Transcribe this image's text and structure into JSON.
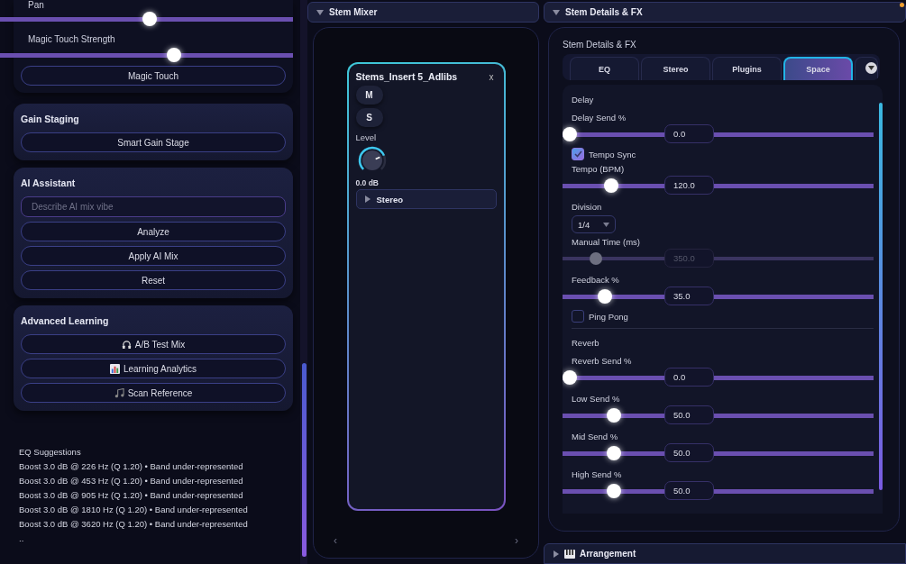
{
  "left_panel": {
    "sliders": [
      {
        "label": "Pan",
        "level": 0.51
      },
      {
        "label": "Magic Touch Strength",
        "level": 0.6
      }
    ],
    "magic_button": "Magic Touch",
    "cards": [
      {
        "title": "Gain Staging",
        "items": [
          {
            "kind": "button",
            "label": "Smart Gain Stage"
          }
        ]
      },
      {
        "title": "AI Assistant",
        "items": [
          {
            "kind": "input",
            "placeholder": "Describe AI mix vibe"
          },
          {
            "kind": "button",
            "label": "Analyze"
          },
          {
            "kind": "button",
            "label": "Apply AI Mix"
          },
          {
            "kind": "button",
            "label": "Reset"
          }
        ]
      },
      {
        "title": "Advanced Learning",
        "items": [
          {
            "kind": "icon-button",
            "label": "A/B Test Mix"
          },
          {
            "kind": "icon-button",
            "label": "Learning Analytics"
          },
          {
            "kind": "icon-button",
            "label": "Scan Reference"
          }
        ]
      }
    ],
    "eq_suggestions": {
      "title": "EQ Suggestions",
      "lines": [
        "Boost 3.0 dB @ 226 Hz (Q 1.20) • Band under-represented",
        "Boost 3.0 dB @ 453 Hz (Q 1.20) • Band under-represented",
        "Boost 3.0 dB @ 905 Hz (Q 1.20) • Band under-represented",
        "Boost 3.0 dB @ 1810 Hz (Q 1.20) • Band under-represented",
        "Boost 3.0 dB @ 3620 Hz (Q 1.20) • Band under-represented"
      ],
      "more": ".."
    }
  },
  "stem_mixer": {
    "title": "Stem Mixer",
    "expanded": true,
    "channel": {
      "name": "Stems_Insert 5_Adlibs",
      "close": "x",
      "mute": "M",
      "solo": "S",
      "level_label": "Level",
      "level": 0.75,
      "reading": "0.0 dB",
      "stereo": {
        "label": "Stereo",
        "expanded": false
      }
    },
    "nav": [
      "‹",
      "›"
    ]
  },
  "stem_details": {
    "title": "Stem Details & FX",
    "expanded": true,
    "subtitle": "Stem Details & FX",
    "tabs": [
      {
        "label": "EQ",
        "selected": false
      },
      {
        "label": "Stereo",
        "selected": false
      },
      {
        "label": "Plugins",
        "selected": false
      },
      {
        "label": "Space",
        "selected": true
      }
    ],
    "items": [
      {
        "kind": "heading",
        "label": "Delay"
      },
      {
        "kind": "slider",
        "label": "Delay Send %",
        "level": 0,
        "value": "0.0",
        "disabled": false
      },
      {
        "kind": "checkbox",
        "label": "Tempo Sync",
        "checked": true
      },
      {
        "kind": "slider",
        "label": "Tempo (BPM)",
        "level": 0.14,
        "value": "120.0",
        "disabled": false
      },
      {
        "kind": "select",
        "label": "Division",
        "value": "1/4"
      },
      {
        "kind": "slider",
        "label": "Manual Time (ms)",
        "level": 0.09,
        "value": "350.0",
        "disabled": true
      },
      {
        "kind": "slider",
        "label": "Feedback %",
        "level": 0.12,
        "value": "35.0",
        "disabled": false
      },
      {
        "kind": "checkbox",
        "label": "Ping Pong",
        "checked": false
      },
      {
        "kind": "heading",
        "label": "Reverb"
      },
      {
        "kind": "slider",
        "label": "Reverb Send %",
        "level": 0,
        "value": "0.0",
        "disabled": false
      },
      {
        "kind": "slider",
        "label": "Low Send %",
        "level": 0.15,
        "value": "50.0",
        "disabled": false
      },
      {
        "kind": "slider",
        "label": "Mid Send %",
        "level": 0.15,
        "value": "50.0",
        "disabled": false
      },
      {
        "kind": "slider",
        "label": "High Send %",
        "level": 0.15,
        "value": "50.0",
        "disabled": false
      }
    ]
  },
  "arrangement": {
    "title": "Arrangement",
    "expanded": false
  }
}
